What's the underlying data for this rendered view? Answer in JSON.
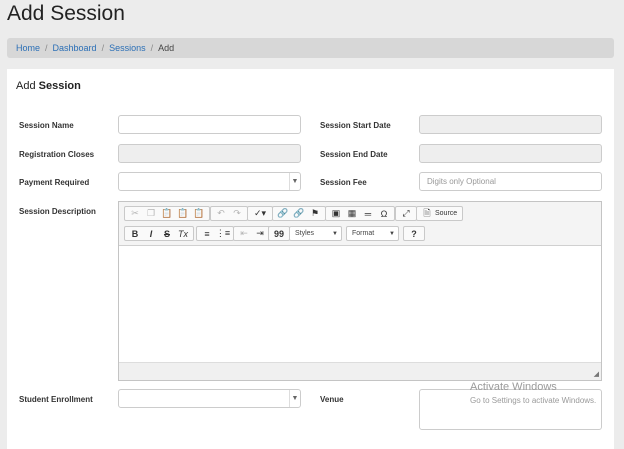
{
  "page": {
    "title": "Add Session"
  },
  "breadcrumb": {
    "items": [
      "Home",
      "Dashboard",
      "Sessions"
    ],
    "separator": "/",
    "current": "Add"
  },
  "panel": {
    "title_prefix": "Add ",
    "title_bold": "Session"
  },
  "form": {
    "session_name": {
      "label": "Session Name",
      "value": ""
    },
    "session_start_date": {
      "label": "Session Start Date",
      "value": ""
    },
    "registration_closes": {
      "label": "Registration Closes",
      "value": ""
    },
    "session_end_date": {
      "label": "Session End Date",
      "value": ""
    },
    "payment_required": {
      "label": "Payment Required",
      "value": ""
    },
    "session_fee": {
      "label": "Session Fee",
      "placeholder": "Digits only  Optional"
    },
    "session_description": {
      "label": "Session Description"
    },
    "student_enrollment": {
      "label": "Student Enrollment",
      "value": ""
    },
    "venue": {
      "label": "Venue",
      "value": ""
    }
  },
  "editor": {
    "source_label": "Source",
    "styles_label": "Styles",
    "format_label": "Format",
    "help_label": "?",
    "bold": "B",
    "italic": "I",
    "strike": "S",
    "remove_format": "Tx",
    "blockquote": "99",
    "special_char": "Ω"
  },
  "watermark": {
    "line1": "Activate Windows",
    "line2": "Go to Settings to activate Windows."
  }
}
